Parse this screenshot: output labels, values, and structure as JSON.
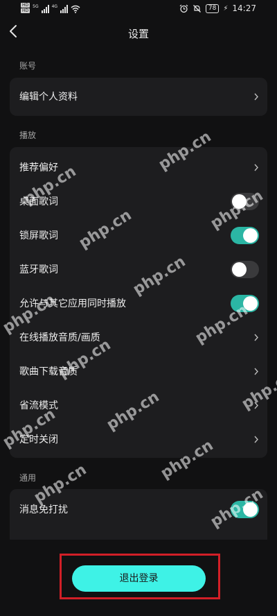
{
  "status_bar": {
    "hd1": "HD",
    "hd2": "HD",
    "net1": "5G",
    "net2": "4G",
    "battery": "78",
    "time": "14:27"
  },
  "nav": {
    "title": "设置"
  },
  "sections": {
    "account": {
      "label": "账号",
      "items": [
        {
          "label": "编辑个人资料",
          "control": "chevron"
        }
      ]
    },
    "playback": {
      "label": "播放",
      "items": [
        {
          "label": "推荐偏好",
          "control": "chevron"
        },
        {
          "label": "桌面歌词",
          "control": "toggle",
          "on": false
        },
        {
          "label": "锁屏歌词",
          "control": "toggle",
          "on": true
        },
        {
          "label": "蓝牙歌词",
          "control": "toggle",
          "on": false
        },
        {
          "label": "允许与其它应用同时播放",
          "control": "toggle",
          "on": true
        },
        {
          "label": "在线播放音质/画质",
          "control": "chevron"
        },
        {
          "label": "歌曲下载音质",
          "control": "chevron"
        },
        {
          "label": "省流模式",
          "control": "chevron"
        },
        {
          "label": "定时关闭",
          "control": "chevron"
        }
      ]
    },
    "general": {
      "label": "通用",
      "items": [
        {
          "label": "消息免打扰",
          "control": "toggle",
          "on": true
        }
      ]
    }
  },
  "logout": {
    "label": "退出登录"
  },
  "watermark": "php.cn",
  "colors": {
    "background": "#111112",
    "card": "#1d1d1f",
    "toggle_on": "#2bb6a4",
    "toggle_off": "#3a3a3c",
    "logout_button": "#3ef2e6",
    "highlight_box": "#d21f27"
  }
}
